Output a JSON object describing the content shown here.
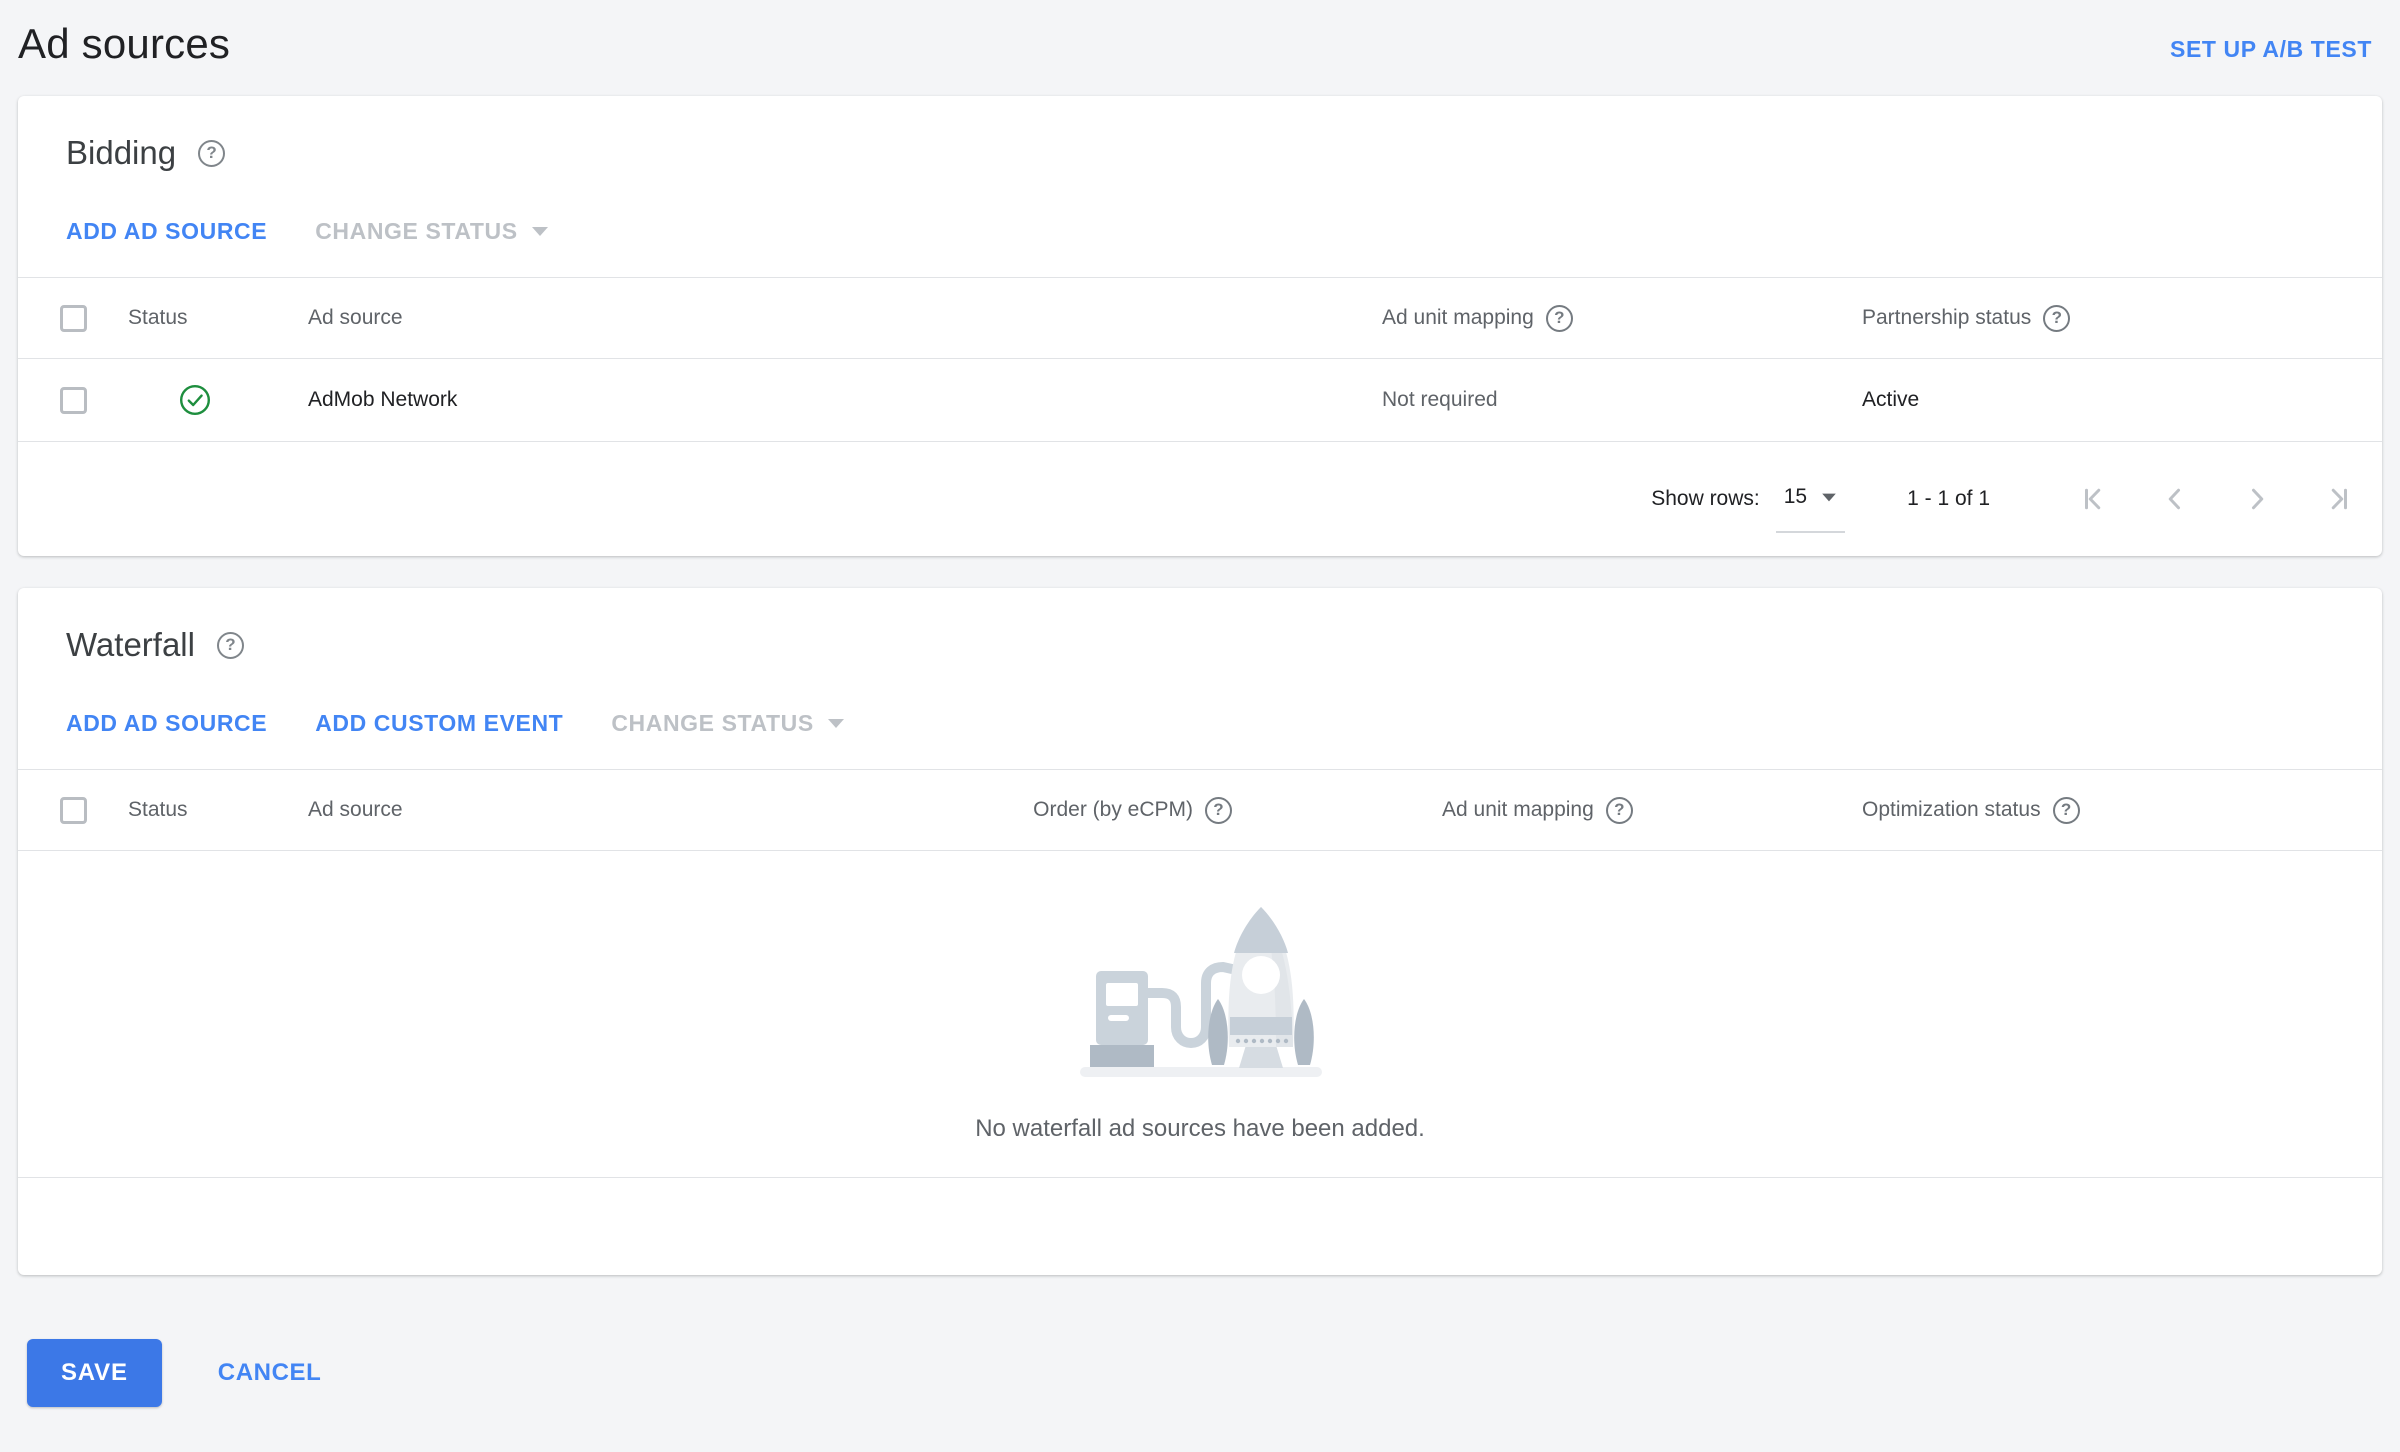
{
  "page": {
    "title": "Ad sources",
    "setup_ab_test": "SET UP A/B TEST"
  },
  "bidding": {
    "title": "Bidding",
    "actions": {
      "add_ad_source": "ADD AD SOURCE",
      "change_status": "CHANGE STATUS"
    },
    "table": {
      "headers": {
        "status": "Status",
        "ad_source": "Ad source",
        "ad_unit_mapping": "Ad unit mapping",
        "partnership_status": "Partnership status"
      },
      "rows": [
        {
          "status": "enabled",
          "ad_source": "AdMob Network",
          "ad_unit_mapping": "Not required",
          "partnership_status": "Active"
        }
      ]
    },
    "pagination": {
      "show_rows_label": "Show rows:",
      "rows_per_page": "15",
      "range": "1 - 1 of 1"
    }
  },
  "waterfall": {
    "title": "Waterfall",
    "actions": {
      "add_ad_source": "ADD AD SOURCE",
      "add_custom_event": "ADD CUSTOM EVENT",
      "change_status": "CHANGE STATUS"
    },
    "table": {
      "headers": {
        "status": "Status",
        "ad_source": "Ad source",
        "order": "Order (by eCPM)",
        "ad_unit_mapping": "Ad unit mapping",
        "optimization_status": "Optimization status"
      }
    },
    "empty_state": {
      "message": "No waterfall ad sources have been added."
    }
  },
  "footer": {
    "save": "SAVE",
    "cancel": "CANCEL"
  },
  "colors": {
    "page_bg": "#F4F5F7",
    "card_bg": "#FFFFFF",
    "link_blue": "#4285F4",
    "save_button_bg": "#3C78E7",
    "save_button_text": "#FFFFFF",
    "text_primary": "#202124",
    "text_secondary": "#5F6368",
    "disabled_gray": "#BDC1C6",
    "divider": "#E1E3E6",
    "success_green": "#1E8E3E"
  }
}
